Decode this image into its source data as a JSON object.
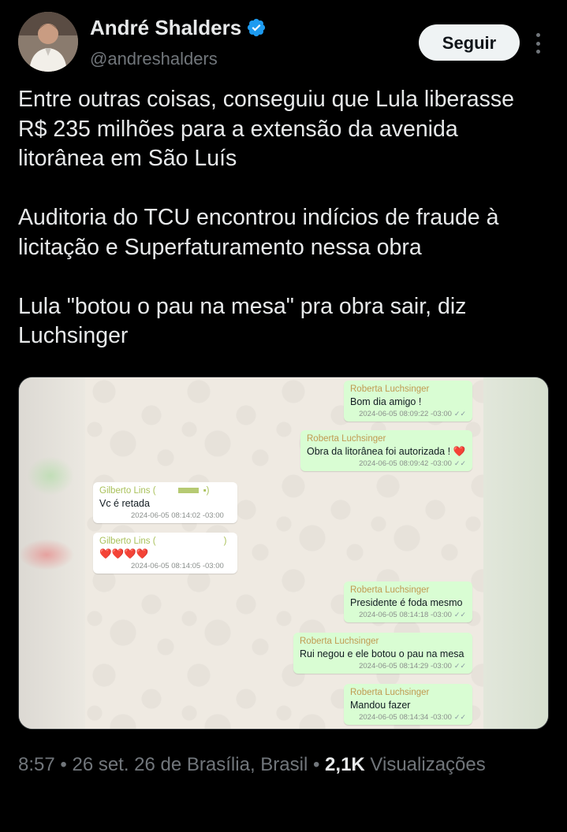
{
  "author": {
    "display_name": "André Shalders",
    "handle": "@andreshalders",
    "verified": true
  },
  "follow_label": "Seguir",
  "tweet": {
    "paragraphs": [
      "Entre outras coisas, conseguiu que Lula liberasse R$ 235 milhões para a extensão da avenida litorânea em São Luís",
      "Auditoria do TCU encontrou indícios de fraude à licitação e Superfaturamento nessa obra",
      "Lula \"botou o pau na mesa\" pra obra sair, diz Luchsinger"
    ]
  },
  "chat": {
    "messages": [
      {
        "direction": "out",
        "sender": "Roberta Luchsinger",
        "text": "Bom dia amigo !",
        "timestamp": "2024-06-05 08:09:22 -03:00"
      },
      {
        "direction": "out",
        "sender": "Roberta Luchsinger",
        "text": "Obra da litorânea foi autorizada ! ❤️",
        "timestamp": "2024-06-05 08:09:42 -03:00"
      },
      {
        "direction": "in",
        "sender": "Gilberto Lins (",
        "text": "Vc é retada",
        "timestamp": "2024-06-05 08:14:02 -03:00"
      },
      {
        "direction": "in",
        "sender": "Gilberto Lins (",
        "text": "❤️❤️❤️❤️",
        "timestamp": "2024-06-05 08:14:05 -03:00"
      },
      {
        "direction": "out",
        "sender": "Roberta Luchsinger",
        "text": "Presidente é foda mesmo",
        "timestamp": "2024-06-05 08:14:18 -03:00"
      },
      {
        "direction": "out",
        "sender": "Roberta Luchsinger",
        "text": "Rui negou e ele botou o pau na mesa",
        "timestamp": "2024-06-05 08:14:29 -03:00"
      },
      {
        "direction": "out",
        "sender": "Roberta Luchsinger",
        "text": "Mandou fazer",
        "timestamp": "2024-06-05 08:14:34 -03:00"
      }
    ]
  },
  "footer": {
    "time": "8:57",
    "separator": "•",
    "date": "26 set. 26 de Brasília, Brasil",
    "views_count": "2,1K",
    "views_label": "Visualizações"
  },
  "colors": {
    "background": "#000000",
    "text_primary": "#e7e9ea",
    "text_secondary": "#71767b",
    "verified_blue": "#1d9bf0",
    "follow_button_bg": "#eff3f4"
  }
}
